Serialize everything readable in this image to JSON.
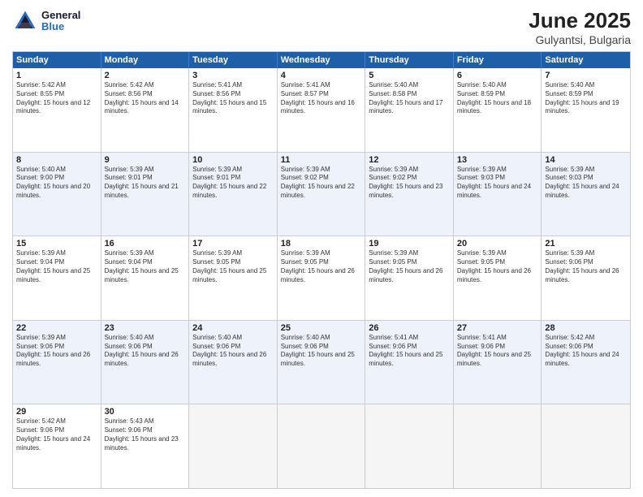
{
  "logo": {
    "line1": "General",
    "line2": "Blue"
  },
  "title": "June 2025",
  "location": "Gulyantsi, Bulgaria",
  "weekdays": [
    "Sunday",
    "Monday",
    "Tuesday",
    "Wednesday",
    "Thursday",
    "Friday",
    "Saturday"
  ],
  "rows": [
    [
      {
        "day": "1",
        "sunrise": "Sunrise: 5:42 AM",
        "sunset": "Sunset: 8:55 PM",
        "daylight": "Daylight: 15 hours and 12 minutes."
      },
      {
        "day": "2",
        "sunrise": "Sunrise: 5:42 AM",
        "sunset": "Sunset: 8:56 PM",
        "daylight": "Daylight: 15 hours and 14 minutes."
      },
      {
        "day": "3",
        "sunrise": "Sunrise: 5:41 AM",
        "sunset": "Sunset: 8:56 PM",
        "daylight": "Daylight: 15 hours and 15 minutes."
      },
      {
        "day": "4",
        "sunrise": "Sunrise: 5:41 AM",
        "sunset": "Sunset: 8:57 PM",
        "daylight": "Daylight: 15 hours and 16 minutes."
      },
      {
        "day": "5",
        "sunrise": "Sunrise: 5:40 AM",
        "sunset": "Sunset: 8:58 PM",
        "daylight": "Daylight: 15 hours and 17 minutes."
      },
      {
        "day": "6",
        "sunrise": "Sunrise: 5:40 AM",
        "sunset": "Sunset: 8:59 PM",
        "daylight": "Daylight: 15 hours and 18 minutes."
      },
      {
        "day": "7",
        "sunrise": "Sunrise: 5:40 AM",
        "sunset": "Sunset: 8:59 PM",
        "daylight": "Daylight: 15 hours and 19 minutes."
      }
    ],
    [
      {
        "day": "8",
        "sunrise": "Sunrise: 5:40 AM",
        "sunset": "Sunset: 9:00 PM",
        "daylight": "Daylight: 15 hours and 20 minutes."
      },
      {
        "day": "9",
        "sunrise": "Sunrise: 5:39 AM",
        "sunset": "Sunset: 9:01 PM",
        "daylight": "Daylight: 15 hours and 21 minutes."
      },
      {
        "day": "10",
        "sunrise": "Sunrise: 5:39 AM",
        "sunset": "Sunset: 9:01 PM",
        "daylight": "Daylight: 15 hours and 22 minutes."
      },
      {
        "day": "11",
        "sunrise": "Sunrise: 5:39 AM",
        "sunset": "Sunset: 9:02 PM",
        "daylight": "Daylight: 15 hours and 22 minutes."
      },
      {
        "day": "12",
        "sunrise": "Sunrise: 5:39 AM",
        "sunset": "Sunset: 9:02 PM",
        "daylight": "Daylight: 15 hours and 23 minutes."
      },
      {
        "day": "13",
        "sunrise": "Sunrise: 5:39 AM",
        "sunset": "Sunset: 9:03 PM",
        "daylight": "Daylight: 15 hours and 24 minutes."
      },
      {
        "day": "14",
        "sunrise": "Sunrise: 5:39 AM",
        "sunset": "Sunset: 9:03 PM",
        "daylight": "Daylight: 15 hours and 24 minutes."
      }
    ],
    [
      {
        "day": "15",
        "sunrise": "Sunrise: 5:39 AM",
        "sunset": "Sunset: 9:04 PM",
        "daylight": "Daylight: 15 hours and 25 minutes."
      },
      {
        "day": "16",
        "sunrise": "Sunrise: 5:39 AM",
        "sunset": "Sunset: 9:04 PM",
        "daylight": "Daylight: 15 hours and 25 minutes."
      },
      {
        "day": "17",
        "sunrise": "Sunrise: 5:39 AM",
        "sunset": "Sunset: 9:05 PM",
        "daylight": "Daylight: 15 hours and 25 minutes."
      },
      {
        "day": "18",
        "sunrise": "Sunrise: 5:39 AM",
        "sunset": "Sunset: 9:05 PM",
        "daylight": "Daylight: 15 hours and 26 minutes."
      },
      {
        "day": "19",
        "sunrise": "Sunrise: 5:39 AM",
        "sunset": "Sunset: 9:05 PM",
        "daylight": "Daylight: 15 hours and 26 minutes."
      },
      {
        "day": "20",
        "sunrise": "Sunrise: 5:39 AM",
        "sunset": "Sunset: 9:05 PM",
        "daylight": "Daylight: 15 hours and 26 minutes."
      },
      {
        "day": "21",
        "sunrise": "Sunrise: 5:39 AM",
        "sunset": "Sunset: 9:06 PM",
        "daylight": "Daylight: 15 hours and 26 minutes."
      }
    ],
    [
      {
        "day": "22",
        "sunrise": "Sunrise: 5:39 AM",
        "sunset": "Sunset: 9:06 PM",
        "daylight": "Daylight: 15 hours and 26 minutes."
      },
      {
        "day": "23",
        "sunrise": "Sunrise: 5:40 AM",
        "sunset": "Sunset: 9:06 PM",
        "daylight": "Daylight: 15 hours and 26 minutes."
      },
      {
        "day": "24",
        "sunrise": "Sunrise: 5:40 AM",
        "sunset": "Sunset: 9:06 PM",
        "daylight": "Daylight: 15 hours and 26 minutes."
      },
      {
        "day": "25",
        "sunrise": "Sunrise: 5:40 AM",
        "sunset": "Sunset: 9:06 PM",
        "daylight": "Daylight: 15 hours and 25 minutes."
      },
      {
        "day": "26",
        "sunrise": "Sunrise: 5:41 AM",
        "sunset": "Sunset: 9:06 PM",
        "daylight": "Daylight: 15 hours and 25 minutes."
      },
      {
        "day": "27",
        "sunrise": "Sunrise: 5:41 AM",
        "sunset": "Sunset: 9:06 PM",
        "daylight": "Daylight: 15 hours and 25 minutes."
      },
      {
        "day": "28",
        "sunrise": "Sunrise: 5:42 AM",
        "sunset": "Sunset: 9:06 PM",
        "daylight": "Daylight: 15 hours and 24 minutes."
      }
    ],
    [
      {
        "day": "29",
        "sunrise": "Sunrise: 5:42 AM",
        "sunset": "Sunset: 9:06 PM",
        "daylight": "Daylight: 15 hours and 24 minutes."
      },
      {
        "day": "30",
        "sunrise": "Sunrise: 5:43 AM",
        "sunset": "Sunset: 9:06 PM",
        "daylight": "Daylight: 15 hours and 23 minutes."
      },
      {
        "day": "",
        "sunrise": "",
        "sunset": "",
        "daylight": ""
      },
      {
        "day": "",
        "sunrise": "",
        "sunset": "",
        "daylight": ""
      },
      {
        "day": "",
        "sunrise": "",
        "sunset": "",
        "daylight": ""
      },
      {
        "day": "",
        "sunrise": "",
        "sunset": "",
        "daylight": ""
      },
      {
        "day": "",
        "sunrise": "",
        "sunset": "",
        "daylight": ""
      }
    ]
  ]
}
